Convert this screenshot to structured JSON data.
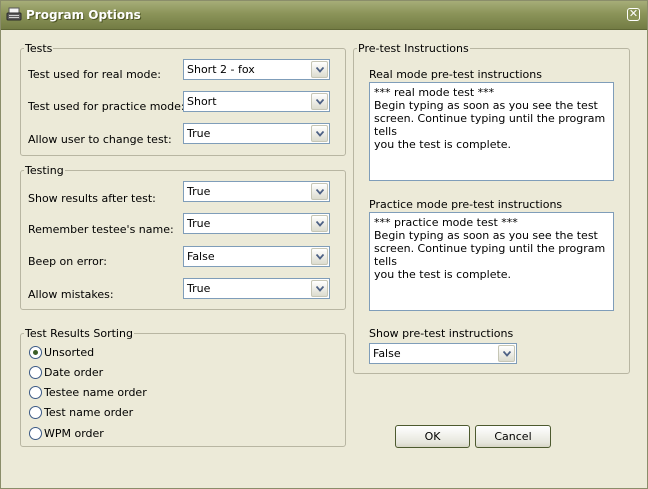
{
  "window": {
    "title": "Program Options",
    "close_glyph": "✕"
  },
  "tests": {
    "legend": "Tests",
    "rows": [
      {
        "label": "Test used for real mode:",
        "value": "Short 2 - fox"
      },
      {
        "label": "Test used for practice mode:",
        "value": "Short"
      },
      {
        "label": "Allow user to change test:",
        "value": "True"
      }
    ]
  },
  "testing": {
    "legend": "Testing",
    "rows": [
      {
        "label": "Show results after test:",
        "value": "True"
      },
      {
        "label": "Remember testee's name:",
        "value": "True"
      },
      {
        "label": "Beep on error:",
        "value": "False"
      },
      {
        "label": "Allow mistakes:",
        "value": "True"
      }
    ]
  },
  "sorting": {
    "legend": "Test Results Sorting",
    "options": [
      {
        "label": "Unsorted",
        "selected": true
      },
      {
        "label": "Date order",
        "selected": false
      },
      {
        "label": "Testee name order",
        "selected": false
      },
      {
        "label": "Test name order",
        "selected": false
      },
      {
        "label": "WPM order",
        "selected": false
      }
    ]
  },
  "pretest": {
    "legend": "Pre-test Instructions",
    "real_label": "Real mode pre-test instructions",
    "real_text": "*** real mode test ***\nBegin typing as soon as you see the test\nscreen. Continue typing until the program tells\nyou the test is complete.",
    "practice_label": "Practice mode pre-test instructions",
    "practice_text": "*** practice mode test ***\nBegin typing as soon as you see the test\nscreen. Continue typing until the program tells\nyou the test is complete.",
    "show_label": "Show pre-test instructions",
    "show_value": "False"
  },
  "buttons": {
    "ok": "OK",
    "cancel": "Cancel"
  },
  "icons": {
    "app": "typewriter-icon",
    "dropdown": "chevron-down-icon",
    "close": "close-icon"
  },
  "colors": {
    "titlebar": "#8b9459",
    "window_bg": "#ecead8",
    "input_border": "#7f9db9"
  }
}
